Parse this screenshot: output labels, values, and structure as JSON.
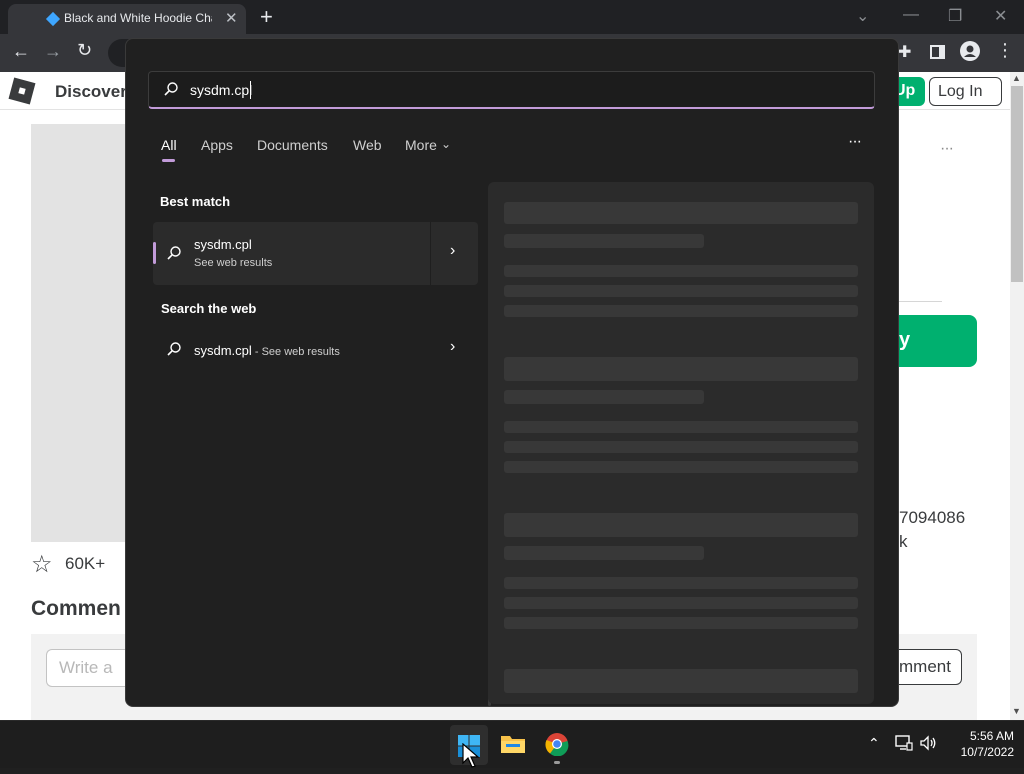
{
  "browser": {
    "tab_title": "Black and White Hoodie Cha",
    "new_tab": "+",
    "close_tab": "✕"
  },
  "roblox": {
    "nav_discover": "Discover",
    "signup_fragment": "Up",
    "login_label": "Log In",
    "overflow_dots": "···",
    "favorites_count": "60K+",
    "comments_heading": "Commen",
    "comment_placeholder": "Write a",
    "comment_button_fragment": "mment",
    "asset_id_fragment": "7094086",
    "side_fragment": "k",
    "buy_fragment": "y"
  },
  "search": {
    "query": "sysdm.cpl",
    "filters": [
      "All",
      "Apps",
      "Documents",
      "Web",
      "More"
    ],
    "active_filter": "All",
    "options_dots": "···",
    "best_match_heading": "Best match",
    "best_match_title": "sysdm.cpl",
    "best_match_subtitle": "See web results",
    "web_heading": "Search the web",
    "web_result_query": "sysdm.cpl",
    "web_result_suffix": " - See web results"
  },
  "taskbar": {
    "time": "5:56 AM",
    "date": "10/7/2022"
  },
  "colors": {
    "search_accent": "#c29bd9",
    "roblox_green": "#00b06f"
  }
}
